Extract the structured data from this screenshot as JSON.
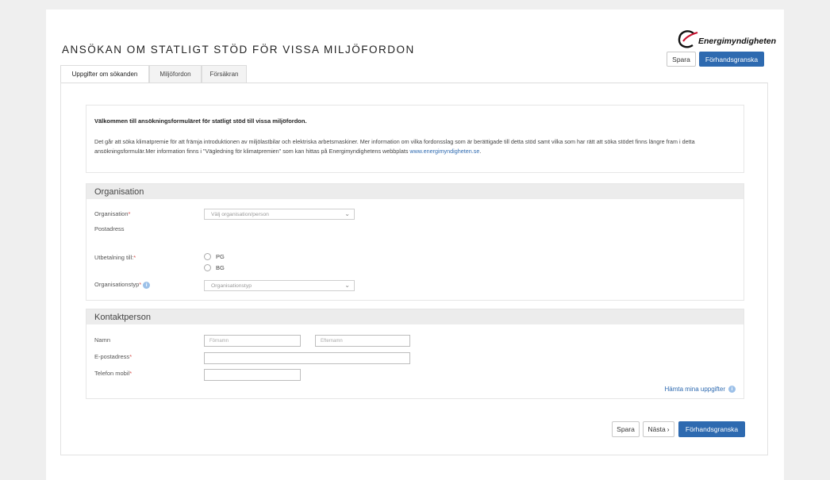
{
  "header": {
    "title": "ANSÖKAN OM STATLIGT STÖD FÖR VISSA MILJÖFORDON",
    "logo_text": "Energimyndigheten",
    "save_label": "Spara",
    "preview_label": "Förhandsgranska"
  },
  "tabs": [
    {
      "label": "Uppgifter om sökanden",
      "active": true
    },
    {
      "label": "Miljöfordon",
      "active": false
    },
    {
      "label": "Försäkran",
      "active": false
    }
  ],
  "intro": {
    "heading": "Välkommen till ansökningsformuläret för statligt stöd till vissa miljöfordon.",
    "body": "Det går att söka klimatpremie för att främja introduktionen av miljölastbilar och elektriska arbetsmaskiner. Mer information om vilka fordonsslag som är berättigade till detta stöd samt vilka som har rätt att söka stödet finns längre fram i detta ansökningsformulär.Mer information finns i \"Vägledning för klimatpremien\" som kan hittas på Energimyndighetens webbplats ",
    "link_text": "www.energimyndigheten.se",
    "body_end": "."
  },
  "organisation": {
    "heading": "Organisation",
    "org_label": "Organisation",
    "org_placeholder": "Välj organisation/person",
    "postadress_label": "Postadress",
    "payment_label": "Utbetalning till:",
    "payment_options": [
      "PG",
      "BG"
    ],
    "orgtype_label": "Organisationstyp",
    "orgtype_placeholder": "Organisationstyp",
    "required_mark": "*"
  },
  "contact": {
    "heading": "Kontaktperson",
    "name_label": "Namn",
    "firstname_placeholder": "Förnamn",
    "lastname_placeholder": "Efternamn",
    "email_label": "E-postadress",
    "phone_label": "Telefon mobil",
    "fetch_link": "Hämta mina uppgifter"
  },
  "footer": {
    "save_label": "Spara",
    "next_label": "Nästa",
    "next_icon": "›",
    "preview_label": "Förhandsgranska"
  },
  "colors": {
    "primary": "#2e6ab0",
    "required": "#d9534f",
    "section_bg": "#ececec",
    "page_bg": "#efefef"
  },
  "icons": {
    "chevron": "⌄",
    "info": "i"
  }
}
